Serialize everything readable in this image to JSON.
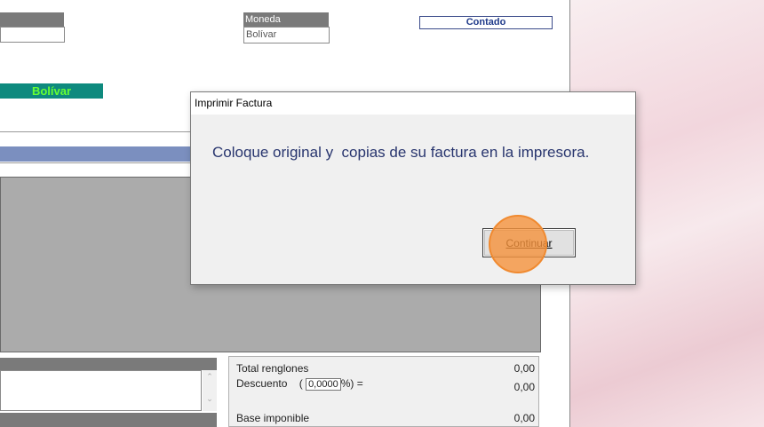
{
  "app": {
    "moneda_label": "Moneda",
    "moneda_value": "Bolívar",
    "condicion": "Contado",
    "currency_badge": "Bolívar"
  },
  "totals": {
    "total_renglones_label": "Total renglones",
    "total_renglones_value": "0,00",
    "descuento_label": "Descuento",
    "descuento_open": "(",
    "descuento_pct": "0,0000",
    "descuento_suffix": "%) =",
    "descuento_value": "0,00",
    "base_imponible_label": "Base imponible",
    "base_imponible_value": "0,00"
  },
  "memo": {
    "scroll_up": "⌃",
    "scroll_down": "⌄"
  },
  "dialog": {
    "title": "Imprimir Factura",
    "message": "Coloque original y  copias de su factura en la impresora.",
    "continue_button": "Continuar"
  },
  "colors": {
    "badge_bg": "#0e8a7e",
    "badge_text": "#66ff33",
    "accent_blue": "#7b8fbf",
    "message_text": "#28356e",
    "click_marker": "#f5923c"
  }
}
